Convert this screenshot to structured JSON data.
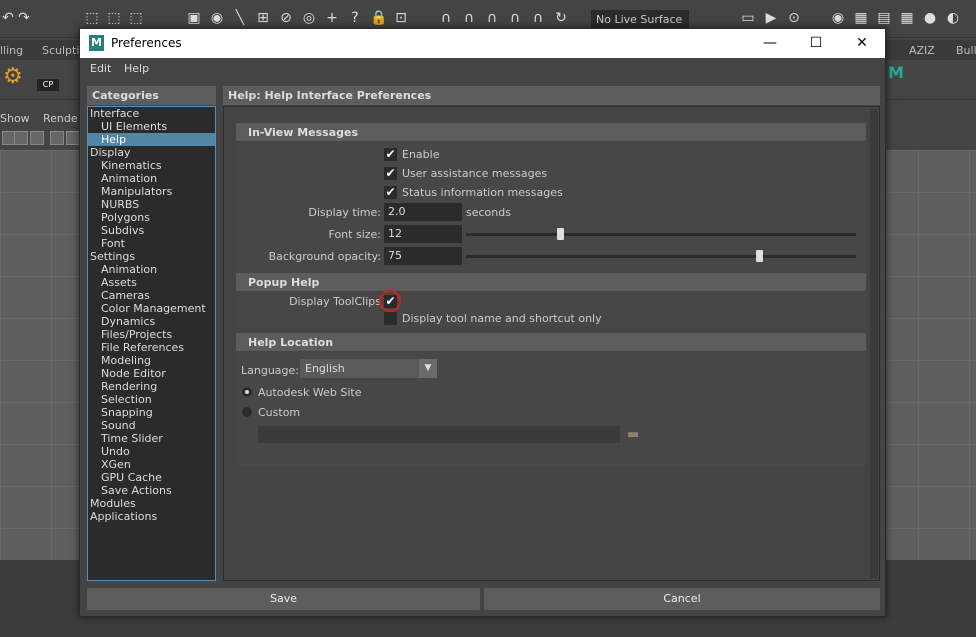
{
  "background": {
    "live_surface": "No Live Surface",
    "shelf_tabs": [
      "lling",
      "Sculptin",
      "AZIZ",
      "Bull"
    ],
    "cp_label": "CP",
    "panel_menu": [
      "Show",
      "Rende"
    ]
  },
  "dialog": {
    "title": "Preferences",
    "menu": [
      "Edit",
      "Help"
    ],
    "controls": {
      "minimize": "—",
      "maximize": "☐",
      "close": "✕"
    }
  },
  "categories": {
    "header": "Categories",
    "items": [
      {
        "label": "Interface",
        "level": 0
      },
      {
        "label": "UI Elements",
        "level": 1
      },
      {
        "label": "Help",
        "level": 1,
        "selected": true
      },
      {
        "label": "Display",
        "level": 0
      },
      {
        "label": "Kinematics",
        "level": 1
      },
      {
        "label": "Animation",
        "level": 1
      },
      {
        "label": "Manipulators",
        "level": 1
      },
      {
        "label": "NURBS",
        "level": 1
      },
      {
        "label": "Polygons",
        "level": 1
      },
      {
        "label": "Subdivs",
        "level": 1
      },
      {
        "label": "Font",
        "level": 1
      },
      {
        "label": "Settings",
        "level": 0
      },
      {
        "label": "Animation",
        "level": 1
      },
      {
        "label": "Assets",
        "level": 1
      },
      {
        "label": "Cameras",
        "level": 1
      },
      {
        "label": "Color Management",
        "level": 1
      },
      {
        "label": "Dynamics",
        "level": 1
      },
      {
        "label": "Files/Projects",
        "level": 1
      },
      {
        "label": "File References",
        "level": 1
      },
      {
        "label": "Modeling",
        "level": 1
      },
      {
        "label": "Node Editor",
        "level": 1
      },
      {
        "label": "Rendering",
        "level": 1
      },
      {
        "label": "Selection",
        "level": 1
      },
      {
        "label": "Snapping",
        "level": 1
      },
      {
        "label": "Sound",
        "level": 1
      },
      {
        "label": "Time Slider",
        "level": 1
      },
      {
        "label": "Undo",
        "level": 1
      },
      {
        "label": "XGen",
        "level": 1
      },
      {
        "label": "GPU Cache",
        "level": 1
      },
      {
        "label": "Save Actions",
        "level": 1
      },
      {
        "label": "Modules",
        "level": 0
      },
      {
        "label": "Applications",
        "level": 0
      }
    ]
  },
  "main": {
    "header": "Help: Help Interface Preferences",
    "inview": {
      "title": "In-View Messages",
      "enable": {
        "label": "Enable",
        "checked": true
      },
      "user_assist": {
        "label": "User assistance messages",
        "checked": true
      },
      "status_info": {
        "label": "Status information messages",
        "checked": true
      },
      "display_time": {
        "label": "Display time:",
        "value": "2.0",
        "unit": "seconds"
      },
      "font_size": {
        "label": "Font size:",
        "value": "12",
        "fraction": 0.24
      },
      "bg_opacity": {
        "label": "Background opacity:",
        "value": "75",
        "fraction": 0.75
      }
    },
    "popup": {
      "title": "Popup Help",
      "toolclips": {
        "label": "Display ToolClips",
        "checked": true
      },
      "shortcut_only": {
        "label": "Display tool name and shortcut only",
        "checked": false
      }
    },
    "location": {
      "title": "Help Location",
      "language_label": "Language:",
      "language_value": "English",
      "autodesk": {
        "label": "Autodesk Web Site",
        "selected": true
      },
      "custom": {
        "label": "Custom",
        "selected": false
      },
      "custom_path": ""
    }
  },
  "buttons": {
    "save": "Save",
    "cancel": "Cancel"
  },
  "colors": {
    "selection": "#5285a6",
    "annotation": "#d01f1f",
    "brand": "#2b7c7c"
  }
}
